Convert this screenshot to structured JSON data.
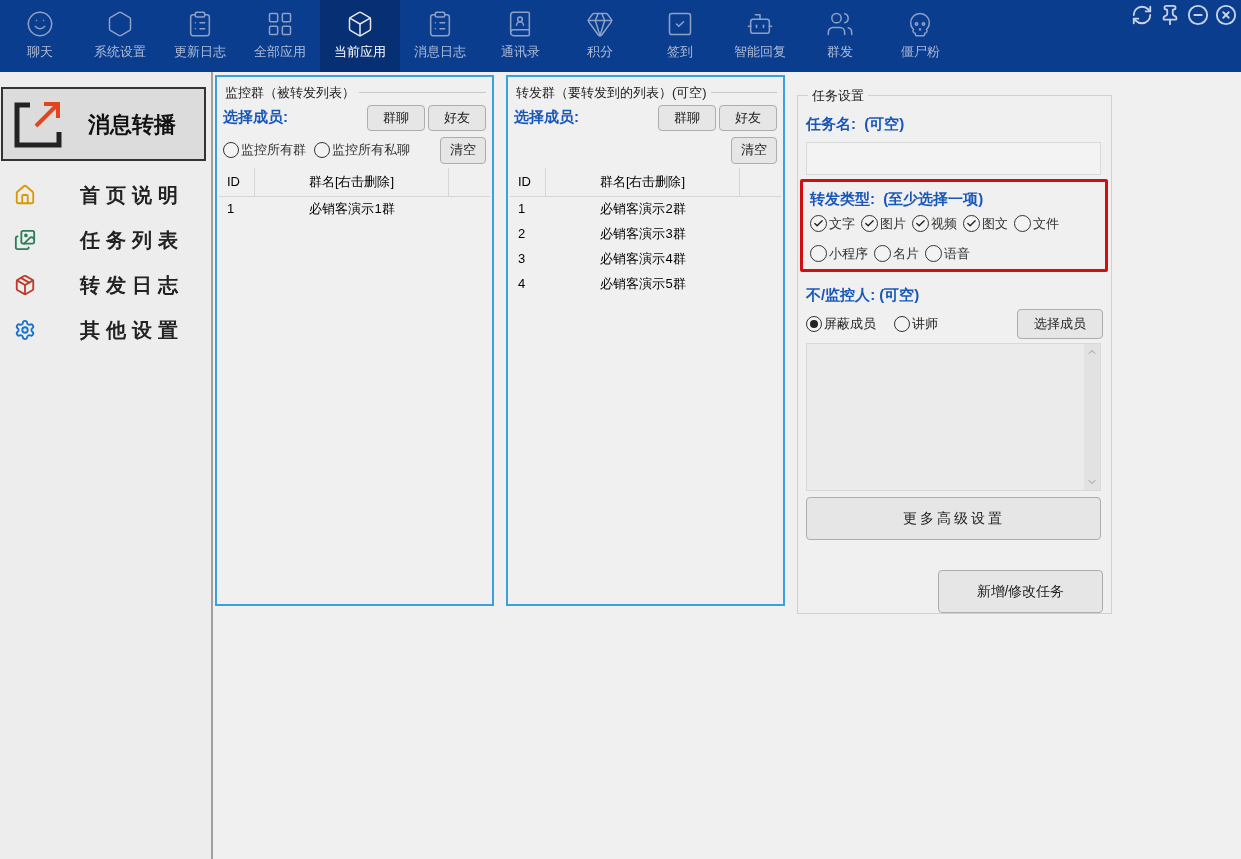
{
  "nav": [
    {
      "label": "聊天",
      "selected": false
    },
    {
      "label": "系统设置",
      "selected": false
    },
    {
      "label": "更新日志",
      "selected": false
    },
    {
      "label": "全部应用",
      "selected": false
    },
    {
      "label": "当前应用",
      "selected": true
    },
    {
      "label": "消息日志",
      "selected": false
    },
    {
      "label": "通讯录",
      "selected": false
    },
    {
      "label": "积分",
      "selected": false
    },
    {
      "label": "签到",
      "selected": false
    },
    {
      "label": "智能回复",
      "selected": false
    },
    {
      "label": "群发",
      "selected": false
    },
    {
      "label": "僵尸粉",
      "selected": false
    }
  ],
  "sidebar": {
    "title": "消息转播",
    "items": [
      {
        "label": "首页说明"
      },
      {
        "label": "任务列表"
      },
      {
        "label": "转发日志"
      },
      {
        "label": "其他设置"
      }
    ]
  },
  "monitor_panel": {
    "title": "监控群（被转发列表）",
    "select_label": "选择成员:",
    "buttons": [
      "群聊",
      "好友"
    ],
    "options": [
      {
        "label": "监控所有群",
        "selected": false
      },
      {
        "label": "监控所有私聊",
        "selected": false
      }
    ],
    "clear_button": "清空",
    "columns": [
      "ID",
      "群名[右击删除]"
    ],
    "rows": [
      [
        "1",
        "必销客演示1群"
      ]
    ]
  },
  "forward_panel": {
    "title": "转发群（要转发到的列表）(可空)",
    "select_label": "选择成员:",
    "buttons": [
      "群聊",
      "好友"
    ],
    "clear_button": "清空",
    "columns": [
      "ID",
      "群名[右击删除]"
    ],
    "rows": [
      [
        "1",
        "必销客演示2群"
      ],
      [
        "2",
        "必销客演示3群"
      ],
      [
        "3",
        "必销客演示4群"
      ],
      [
        "4",
        "必销客演示5群"
      ]
    ]
  },
  "task_panel": {
    "title": "任务设置",
    "name_label": "任务名:  (可空)",
    "type_label": "转发类型:  (至少选择一项)",
    "types": [
      {
        "label": "文字",
        "checked": true
      },
      {
        "label": "图片",
        "checked": true
      },
      {
        "label": "视频",
        "checked": true
      },
      {
        "label": "图文",
        "checked": true
      },
      {
        "label": "文件",
        "checked": false
      },
      {
        "label": "小程序",
        "checked": false
      },
      {
        "label": "名片",
        "checked": false
      },
      {
        "label": "语音",
        "checked": false
      }
    ],
    "people_label": "不/监控人: (可空)",
    "modes": [
      {
        "label": "屏蔽成员",
        "selected": true
      },
      {
        "label": "讲师",
        "selected": false
      }
    ],
    "select_button": "选择成员",
    "advanced_button": "更多高级设置",
    "submit_button": "新增/修改任务"
  }
}
